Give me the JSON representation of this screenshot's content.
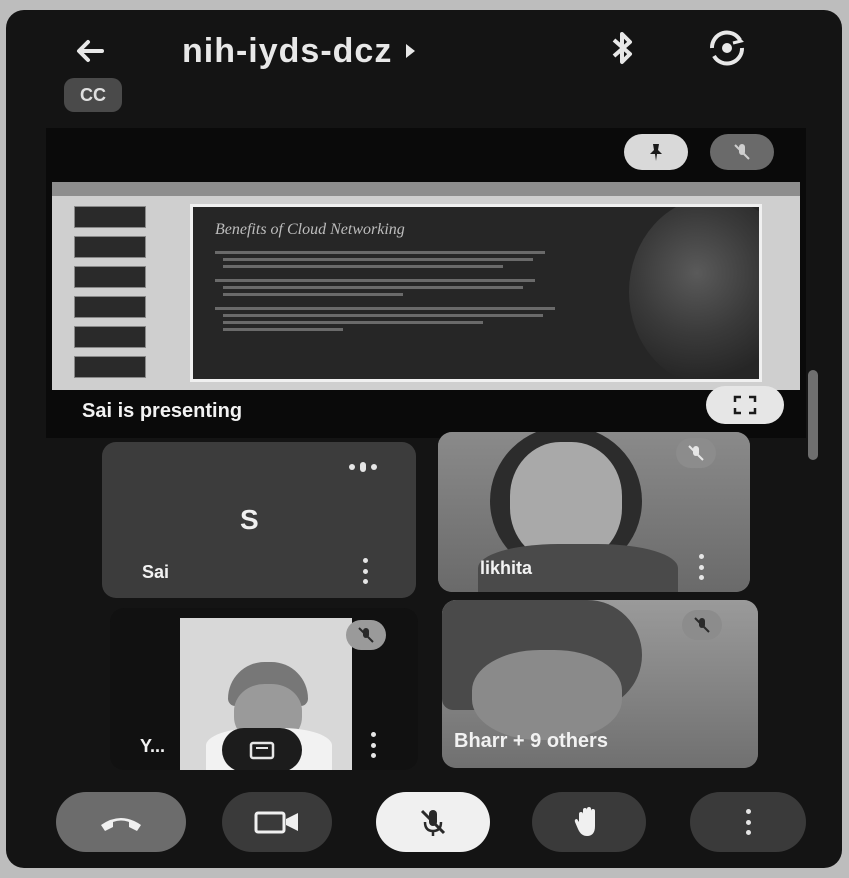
{
  "header": {
    "meeting_code": "nih-iyds-dcz",
    "caption_chip": "CC"
  },
  "presentation": {
    "presenter_label": "Sai is presenting",
    "slide_title": "Benefits of Cloud Networking",
    "slide_bullets": [
      "",
      "",
      ""
    ]
  },
  "participants": [
    {
      "name": "Sai",
      "avatar_letter": "S"
    },
    {
      "name": "likhita"
    },
    {
      "name": "Y..."
    },
    {
      "name": "Bharr + 9 others"
    }
  ],
  "colors": {
    "background": "#141414",
    "tile": "#3c3c3c",
    "end_call": "#6c6c6c",
    "mic_active": "#f0f0f0"
  }
}
